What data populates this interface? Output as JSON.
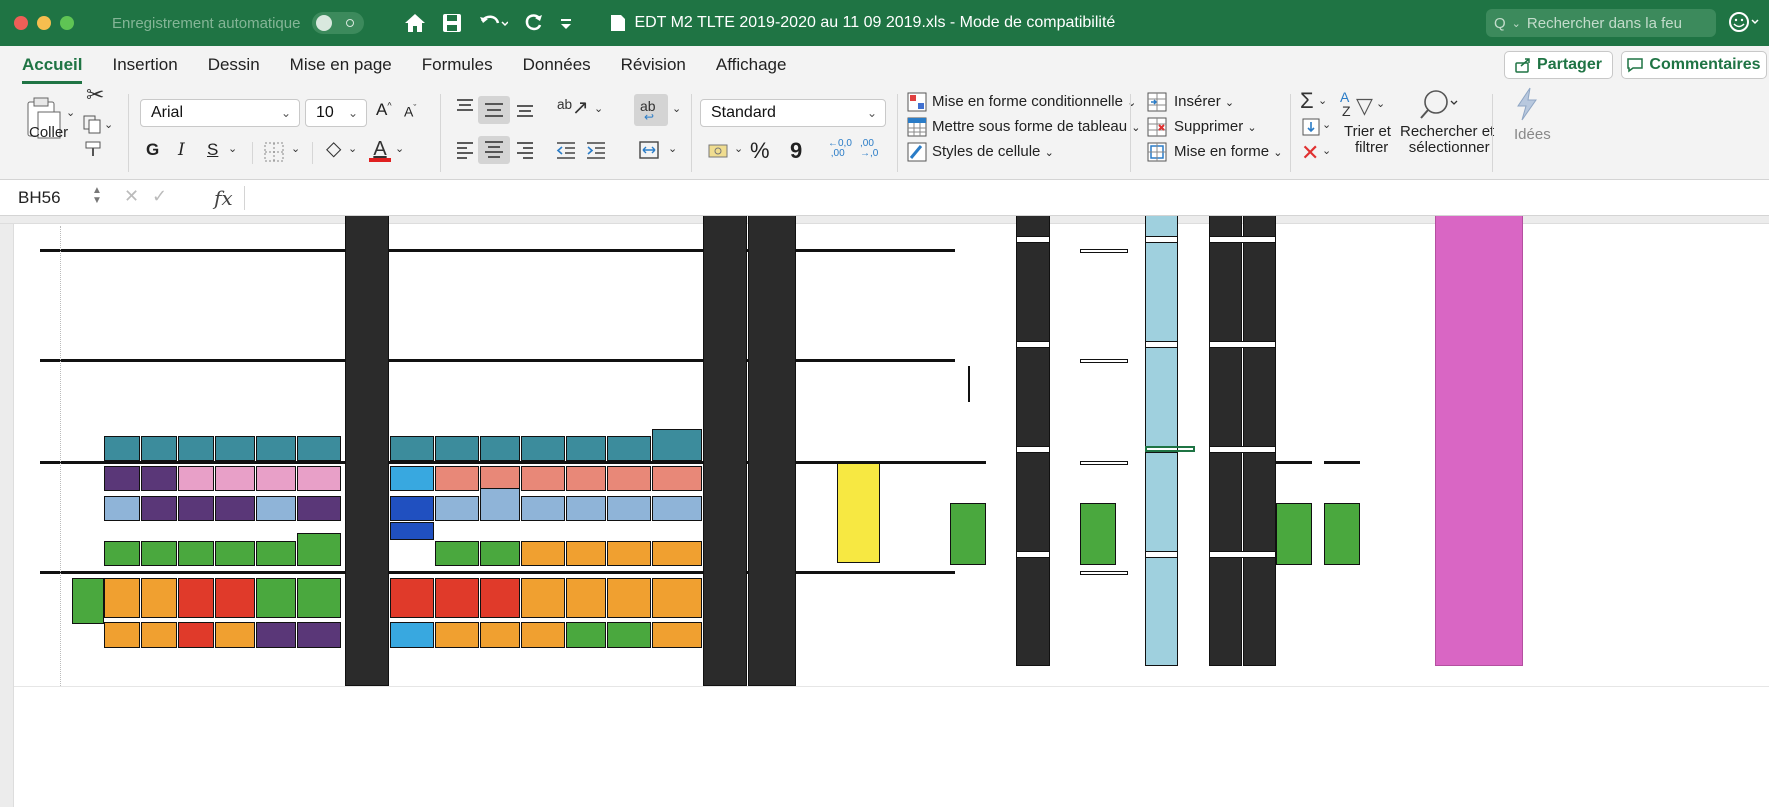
{
  "titlebar": {
    "autosave_label": "Enregistrement automatique",
    "document_title": "EDT M2 TLTE 2019-2020 au 11 09 2019.xls  -  Mode de compatibilité",
    "search_placeholder": "Rechercher dans la feu"
  },
  "menu": {
    "tabs": [
      "Accueil",
      "Insertion",
      "Dessin",
      "Mise en page",
      "Formules",
      "Données",
      "Révision",
      "Affichage"
    ],
    "share_label": "Partager",
    "comments_label": "Commentaires"
  },
  "ribbon": {
    "paste_label": "Coller",
    "font_name": "Arial",
    "font_size": "10",
    "bold": "G",
    "italic": "I",
    "underline": "S",
    "number_format": "Standard",
    "cond_format": "Mise en forme conditionnelle",
    "format_table": "Mettre sous forme de tableau",
    "cell_styles": "Styles de cellule",
    "insert": "Insérer",
    "delete": "Supprimer",
    "format": "Mise en forme",
    "sort_filter_1": "Trier et",
    "sort_filter_2": "filtrer",
    "find_select_1": "Rechercher et",
    "find_select_2": "sélectionner",
    "ideas": "Idées",
    "percent": "%",
    "thousands": "9",
    "font_grow": "A",
    "font_shrink": "A",
    "dec_inc": "0,0",
    "dec_dec": ",00"
  },
  "formula": {
    "cell_ref": "BH56",
    "fx": "fx"
  },
  "colors": {
    "titlebar": "#1f7444",
    "teal": "#3c8c9c",
    "purple": "#5a3778",
    "pink": "#e8a0c8",
    "lightblue": "#8fb4d8",
    "salmon": "#e88878",
    "red": "#e03a2a",
    "orange": "#f0a030",
    "yellow": "#f7e842",
    "green": "#4aa83e",
    "darkgray": "#2b2b2b",
    "skyblue": "#9fd0de",
    "magenta": "#d966c4",
    "blue": "#2050c0",
    "cyan": "#38a8e0"
  }
}
